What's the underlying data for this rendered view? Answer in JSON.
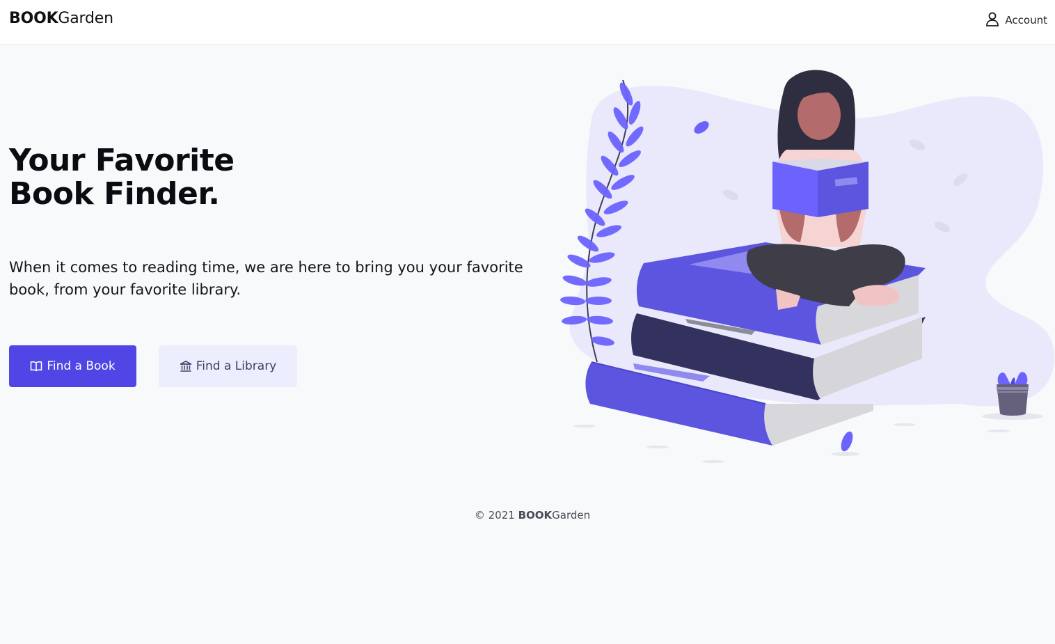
{
  "navbar": {
    "brand_bold": "BOOK",
    "brand_light": "Garden",
    "account_label": "Account",
    "account_icon": "user-icon"
  },
  "hero": {
    "title_line1": "Your Favorite",
    "title_line2": "Book Finder.",
    "description": "When it comes to reading time, we are here to bring you your favorite book, from your favorite library.",
    "primary_button": {
      "label": "Find a Book",
      "icon": "book-open-icon"
    },
    "secondary_button": {
      "label": "Find a Library",
      "icon": "library-icon"
    }
  },
  "footer": {
    "copyright": "© 2021",
    "brand_bold": "BOOK",
    "brand_light": "Garden"
  },
  "colors": {
    "accent": "#4f46e5",
    "secondary_bg": "#eceefd",
    "page_bg": "#f8f9fb",
    "illustration_blob": "#eae9fb"
  }
}
